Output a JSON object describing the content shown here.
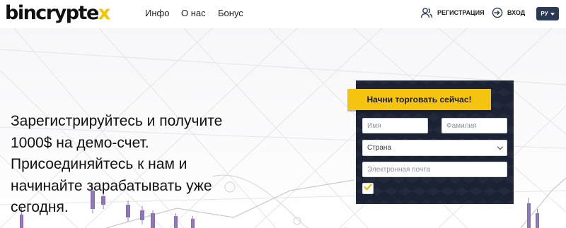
{
  "header": {
    "logo": {
      "prefix": "bincrypte",
      "accent": "x"
    },
    "nav": [
      {
        "label": "Инфо"
      },
      {
        "label": "О нас"
      },
      {
        "label": "Бонус"
      }
    ],
    "register_label": "РЕГИСТРАЦИЯ",
    "login_label": "ВХОД",
    "language": "РУ"
  },
  "hero": {
    "headline": "Зарегистрируйтесь и получите 1000$ на демо-счет. Присоединяйтесь к нам и начинайте зарабатывать уже сегодня."
  },
  "signup_form": {
    "cta_label": "Начни торговать сейчас!",
    "first_name_placeholder": "Имя",
    "last_name_placeholder": "Фамилия",
    "country_selected": "Страна",
    "email_placeholder": "Электронная почта",
    "terms_checked": true
  },
  "colors": {
    "accent_yellow": "#f5c411",
    "panel_navy": "#1b2233",
    "candle_purple": "#8b6fb3",
    "lang_badge": "#2a3a55"
  }
}
